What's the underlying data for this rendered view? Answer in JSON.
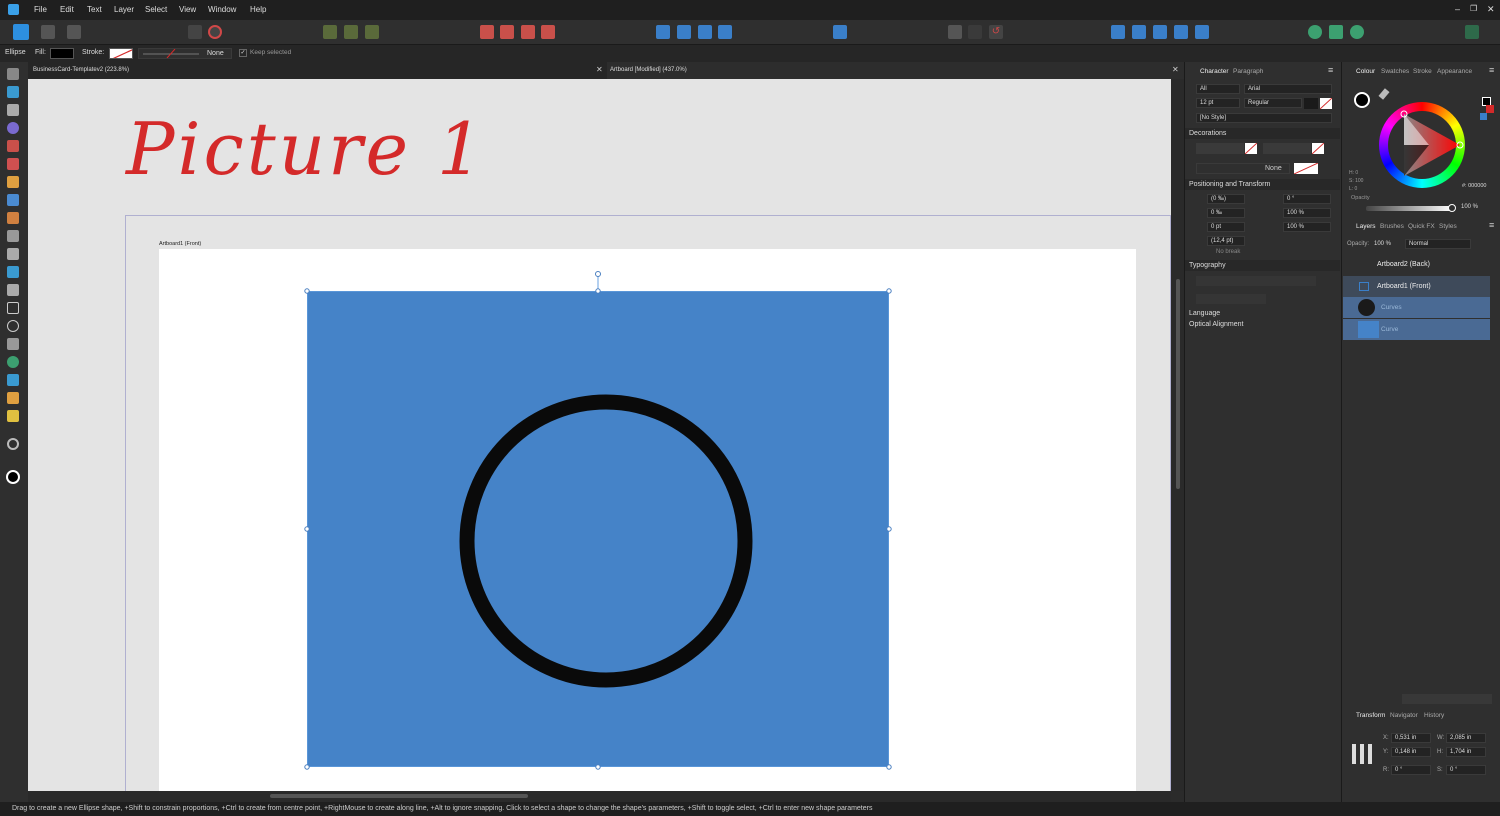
{
  "menu": [
    "File",
    "Edit",
    "Text",
    "Layer",
    "Select",
    "View",
    "Window",
    "Help"
  ],
  "context": {
    "tool": "Ellipse",
    "fill_label": "Fill:",
    "stroke_label": "Stroke:",
    "stroke_style": "None",
    "keep_selected": "Keep selected"
  },
  "tabs": [
    {
      "title": "BusinessCard-Templatev2 (223.8%)"
    },
    {
      "title": "Artboard [Modified] (437.0%)"
    }
  ],
  "canvas": {
    "handwritten_title": "Picture 1",
    "artboard_label": "Artboard1 (Front)"
  },
  "character_panel": {
    "tabs": [
      "Character",
      "Paragraph"
    ],
    "scope": "All",
    "font": "Arial",
    "size": "12 pt",
    "weight": "Regular",
    "style": "[No Style]",
    "decorations_header": "Decorations",
    "decor_none": "None",
    "positioning_header": "Positioning and Transform",
    "fields": {
      "tracking": "(0 ‰)",
      "rotation": "0 °",
      "kerning": "0 ‰",
      "hscale": "100 %",
      "baseline": "0 pt",
      "vscale": "100 %",
      "leading": "(12,4 pt)"
    },
    "no_break": "No break",
    "typography_header": "Typography",
    "language": "Language",
    "optical": "Optical Alignment"
  },
  "colour_panel": {
    "tabs": [
      "Colour",
      "Swatches",
      "Stroke",
      "Appearance"
    ],
    "h": "H: 0",
    "s": "S: 100",
    "l": "L: 0",
    "hex_label": "#: 000000",
    "opacity_label": "Opacity",
    "opacity": "100 %"
  },
  "layers_panel": {
    "tabs": [
      "Layers",
      "Brushes",
      "Quick FX",
      "Styles"
    ],
    "opacity_label": "Opacity:",
    "opacity": "100 %",
    "blend": "Normal",
    "layers": [
      {
        "name": "Artboard2 (Back)"
      },
      {
        "name": "Artboard1 (Front)"
      },
      {
        "name": "Curves"
      },
      {
        "name": "Curve"
      }
    ]
  },
  "transform_panel": {
    "tabs": [
      "Transform",
      "Navigator",
      "History"
    ],
    "x": "0,531 in",
    "y": "0,148 in",
    "w": "2,085 in",
    "h": "1,704 in",
    "r": "0 °",
    "s": "0 °",
    "x_label": "X:",
    "y_label": "Y:",
    "w_label": "W:",
    "h_label": "H:",
    "r_label": "R:",
    "s_label": "S:"
  },
  "status": "Drag to create a new Ellipse shape, +Shift to constrain proportions, +Ctrl to create from centre point, +RightMouse to create along line, +Alt to ignore snapping. Click to select a shape to change the shape's parameters, +Shift to toggle select, +Ctrl to enter new shape parameters",
  "colors": {
    "accent": "#4a8fd6",
    "blue_rect": "#4583c8",
    "handwriting": "#d42a2a",
    "selection": "#4a7fc0"
  }
}
